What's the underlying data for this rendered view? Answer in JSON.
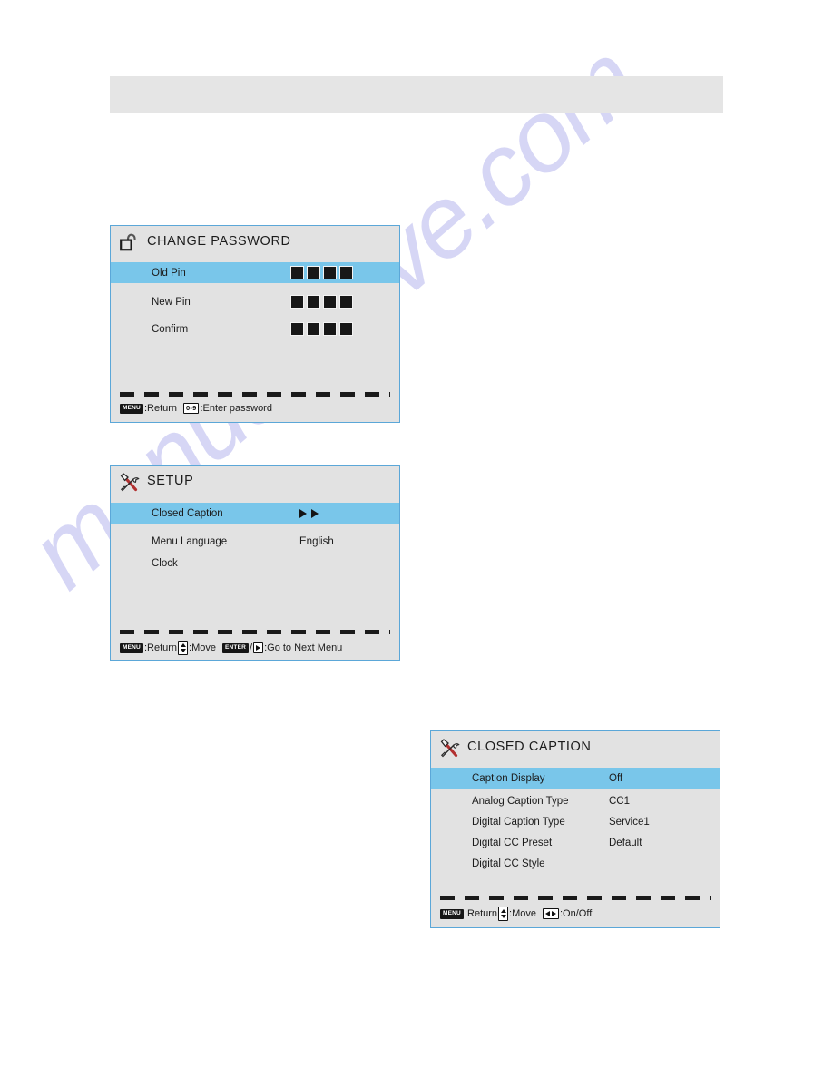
{
  "page": {
    "watermark": "manualshive.com",
    "header_title": ""
  },
  "panels": [
    {
      "id": "change-password",
      "icon": "open-padlock-icon",
      "title": "CHANGE PASSWORD",
      "rows": [
        {
          "label": "Old Pin",
          "value": "",
          "selected": true,
          "pin_boxes": 4
        },
        {
          "label": "New Pin",
          "value": "",
          "selected": false,
          "pin_boxes": 4
        },
        {
          "label": "Confirm",
          "value": "",
          "selected": false,
          "pin_boxes": 4
        }
      ],
      "footer": {
        "key1": "MENU",
        "text1": ":Return",
        "key2": "0-9",
        "text2": ":Enter password"
      }
    },
    {
      "id": "setup",
      "icon": "tools-icon",
      "title": "SETUP",
      "rows": [
        {
          "label": "Closed Caption",
          "value": "",
          "selected": true,
          "arrows": 2
        },
        {
          "label": "Menu Language",
          "value": "English",
          "selected": false
        },
        {
          "label": "Clock",
          "value": "",
          "selected": false
        }
      ],
      "footer": {
        "key1": "MENU",
        "text1": ":Return",
        "text2": ":Move",
        "key3": "ENTER",
        "text3": "/",
        "text4": ":Go to Next Menu"
      }
    },
    {
      "id": "closed-caption",
      "icon": "tools-icon",
      "title": "CLOSED CAPTION",
      "rows": [
        {
          "label": "Caption Display",
          "value": "Off",
          "selected": true
        },
        {
          "label": "Analog Caption Type",
          "value": "CC1",
          "selected": false
        },
        {
          "label": "Digital Caption Type",
          "value": "Service1",
          "selected": false
        },
        {
          "label": "Digital CC Preset",
          "value": "Default",
          "selected": false
        },
        {
          "label": "Digital CC Style",
          "value": "",
          "selected": false
        }
      ],
      "footer": {
        "key1": "MENU",
        "text1": ":Return",
        "text2": ":Move",
        "text3": ":On/Off"
      }
    }
  ],
  "colors": {
    "selection_blue": "#79c6ea",
    "panel_bg": "#e2e2e2",
    "panel_border": "#5ba7d8",
    "header_band": "#e5e5e5",
    "watermark": "#c9c9f2"
  }
}
